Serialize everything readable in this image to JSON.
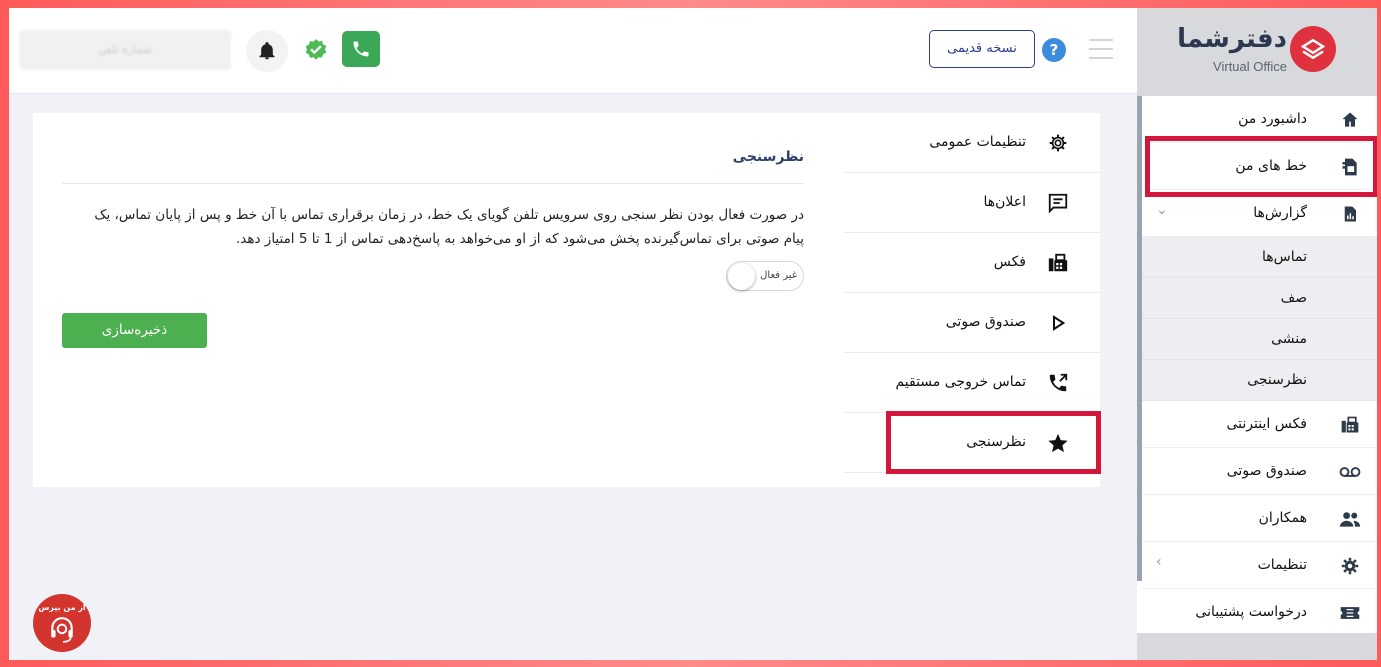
{
  "header": {
    "blurred_text": "شماره تلفن",
    "old_version_label": "نسخه قدیمی",
    "help_label": "?"
  },
  "sidebar": {
    "logo_text": "دفترشما",
    "logo_sub": "Virtual Office",
    "items": [
      {
        "label": "داشبورد من",
        "icon": "home-icon"
      },
      {
        "label": "خط های من",
        "icon": "sim-card-icon"
      },
      {
        "label": "گزارش‌ها",
        "icon": "report-icon"
      },
      {
        "label": "فکس اینترنتی",
        "icon": "fax-icon"
      },
      {
        "label": "صندوق صوتی",
        "icon": "voicemail-icon"
      },
      {
        "label": "همکاران",
        "icon": "people-icon"
      },
      {
        "label": "تنظیمات",
        "icon": "gear-icon"
      },
      {
        "label": "درخواست پشتیبانی",
        "icon": "ticket-icon"
      }
    ],
    "report_subitems": [
      "تماس‌ها",
      "صف",
      "منشی",
      "نظرسنجی"
    ]
  },
  "settings_nav": [
    {
      "label": "تنظیمات عمومی",
      "icon": "gear-icon"
    },
    {
      "label": "اعلان‌ها",
      "icon": "message-icon"
    },
    {
      "label": "فکس",
      "icon": "fax-icon"
    },
    {
      "label": "صندوق صوتی",
      "icon": "play-icon"
    },
    {
      "label": "تماس خروجی مستقیم",
      "icon": "outgoing-call-icon"
    },
    {
      "label": "نظرسنجی",
      "icon": "star-icon"
    }
  ],
  "panel": {
    "title": "نظرسنجی",
    "description": "در صورت فعال بودن نظر سنجی روی سرویس تلفن گویای یک خط، در زمان برقراری تماس با آن خط و پس از پایان تماس، یک پیام صوتی برای تماس‌گیرنده پخش می‌شود که از او می‌خواهد به پاسخ‌دهی تماس از 1 تا 5 امتیاز دهد.",
    "toggle_label": "غیر فعال",
    "toggle_on": false,
    "save_label": "ذخیره‌سازی"
  },
  "support_fab": {
    "label": "از من بپرس"
  },
  "colors": {
    "accent_green": "#4caf50",
    "brand_red": "#e0313f",
    "highlight": "#d3163c",
    "navy": "#2c3e8f"
  }
}
